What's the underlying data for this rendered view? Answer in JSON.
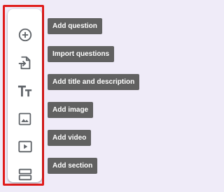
{
  "toolbar": {
    "items": [
      {
        "icon": "add-circle-icon",
        "tooltip": "Add question"
      },
      {
        "icon": "import-icon",
        "tooltip": "Import questions"
      },
      {
        "icon": "title-icon",
        "tooltip": "Add title and description"
      },
      {
        "icon": "image-icon",
        "tooltip": "Add image"
      },
      {
        "icon": "video-icon",
        "tooltip": "Add video"
      },
      {
        "icon": "section-icon",
        "tooltip": "Add section"
      }
    ]
  },
  "colors": {
    "page_background": "#efebf8",
    "tooltip_background": "#616161",
    "highlight_border": "#e01b1b",
    "icon": "#5f6368"
  }
}
